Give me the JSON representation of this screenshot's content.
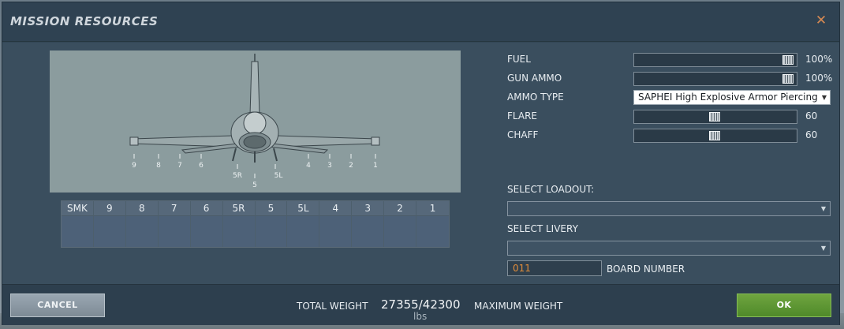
{
  "window": {
    "title": "MISSION RESOURCES",
    "close_symbol": "✕"
  },
  "aircraft_preview": {
    "station_markers": [
      "9",
      "8",
      "7",
      "6",
      "5R",
      "5",
      "5L",
      "4",
      "3",
      "2",
      "1"
    ]
  },
  "pylon_table": {
    "headers": [
      "SMK",
      "9",
      "8",
      "7",
      "6",
      "5R",
      "5",
      "5L",
      "4",
      "3",
      "2",
      "1"
    ]
  },
  "settings": {
    "fuel": {
      "label": "FUEL",
      "value": "100%",
      "fraction": 1.0
    },
    "gun_ammo": {
      "label": "GUN AMMO",
      "value": "100%",
      "fraction": 1.0
    },
    "ammo_type": {
      "label": "AMMO TYPE",
      "selected": "SAPHEI High Explosive Armor Piercing P"
    },
    "flare": {
      "label": "FLARE",
      "value": "60",
      "fraction": 0.5
    },
    "chaff": {
      "label": "CHAFF",
      "value": "60",
      "fraction": 0.5
    }
  },
  "loadout": {
    "label": "SELECT LOADOUT:",
    "selected": ""
  },
  "livery": {
    "label": "SELECT LIVERY",
    "selected": ""
  },
  "board": {
    "value": "011",
    "label": "BOARD NUMBER"
  },
  "footer": {
    "cancel_label": "CANCEL",
    "ok_label": "OK",
    "total_weight_label": "TOTAL WEIGHT",
    "weight_value": "27355/42300",
    "max_weight_label": "MAXIMUM WEIGHT",
    "unit": "lbs"
  },
  "colors": {
    "accent_orange": "#e08c3a",
    "ok_green": "#5a9631",
    "panel": "#3a4e5e"
  },
  "icons": {
    "close": "close-icon",
    "dropdown": "chevron-down-icon"
  }
}
